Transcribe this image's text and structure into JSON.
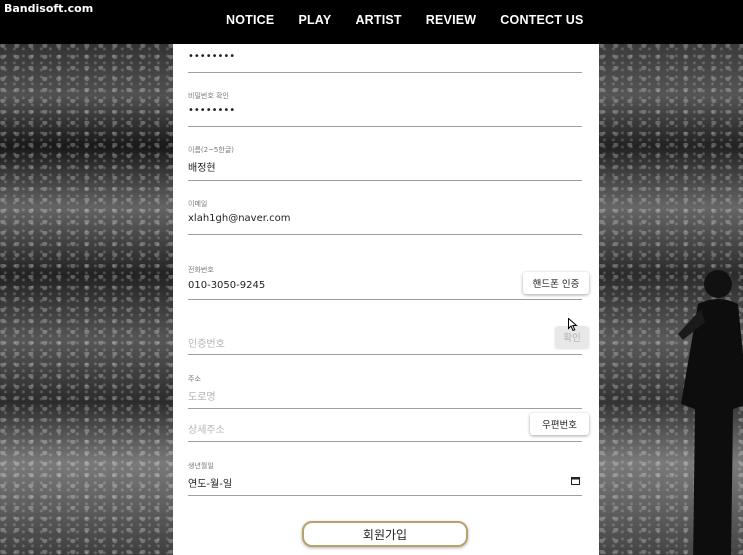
{
  "watermark": "Bandisoft.com",
  "nav": [
    "NOTICE",
    "PLAY",
    "ARTIST",
    "REVIEW",
    "CONTECT US"
  ],
  "form": {
    "password_value": "••••••••",
    "password_confirm_label": "비밀번호 확인",
    "password_confirm_value": "••••••••",
    "name_label": "이름(2~5한글)",
    "name_value": "배정현",
    "email_label": "이메일",
    "email_value": "xlah1gh@naver.com",
    "phone_label": "전화번호",
    "phone_value": "010-3050-9245",
    "phone_verify_button": "핸드폰 인증",
    "auth_placeholder": "인증번호",
    "auth_confirm_button": "확인",
    "address_label": "주소",
    "road_placeholder": "도로명",
    "detail_placeholder": "상세주소",
    "postcode_button": "우편번호",
    "birth_label": "생년월일",
    "birth_value": "연도-월-일",
    "signup_button": "회원가입"
  },
  "icons": {
    "calendar": "calendar-icon",
    "cursor": "mouse-pointer-icon"
  }
}
